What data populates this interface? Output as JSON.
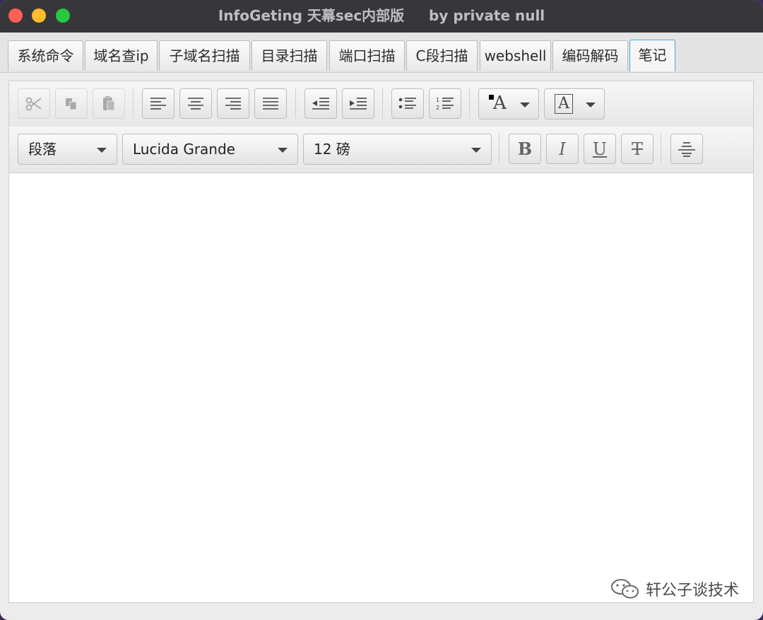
{
  "window": {
    "title": "InfoGeting 天幕sec内部版     by private null"
  },
  "tabs": [
    {
      "label": "系统命令"
    },
    {
      "label": "域名查ip"
    },
    {
      "label": "子域名扫描"
    },
    {
      "label": "目录扫描"
    },
    {
      "label": "端口扫描"
    },
    {
      "label": "C段扫描"
    },
    {
      "label": "webshell"
    },
    {
      "label": "编码解码"
    },
    {
      "label": "笔记"
    }
  ],
  "editor_toolbar": {
    "paragraph_format": "段落",
    "font_family": "Lucida Grande",
    "font_size": "12 磅",
    "bold_glyph": "B",
    "italic_glyph": "I",
    "underline_glyph": "U",
    "strike_glyph": "T",
    "text_color_glyph": "A",
    "bg_color_glyph": "A"
  },
  "watermark": {
    "text": "轩公子谈技术"
  }
}
